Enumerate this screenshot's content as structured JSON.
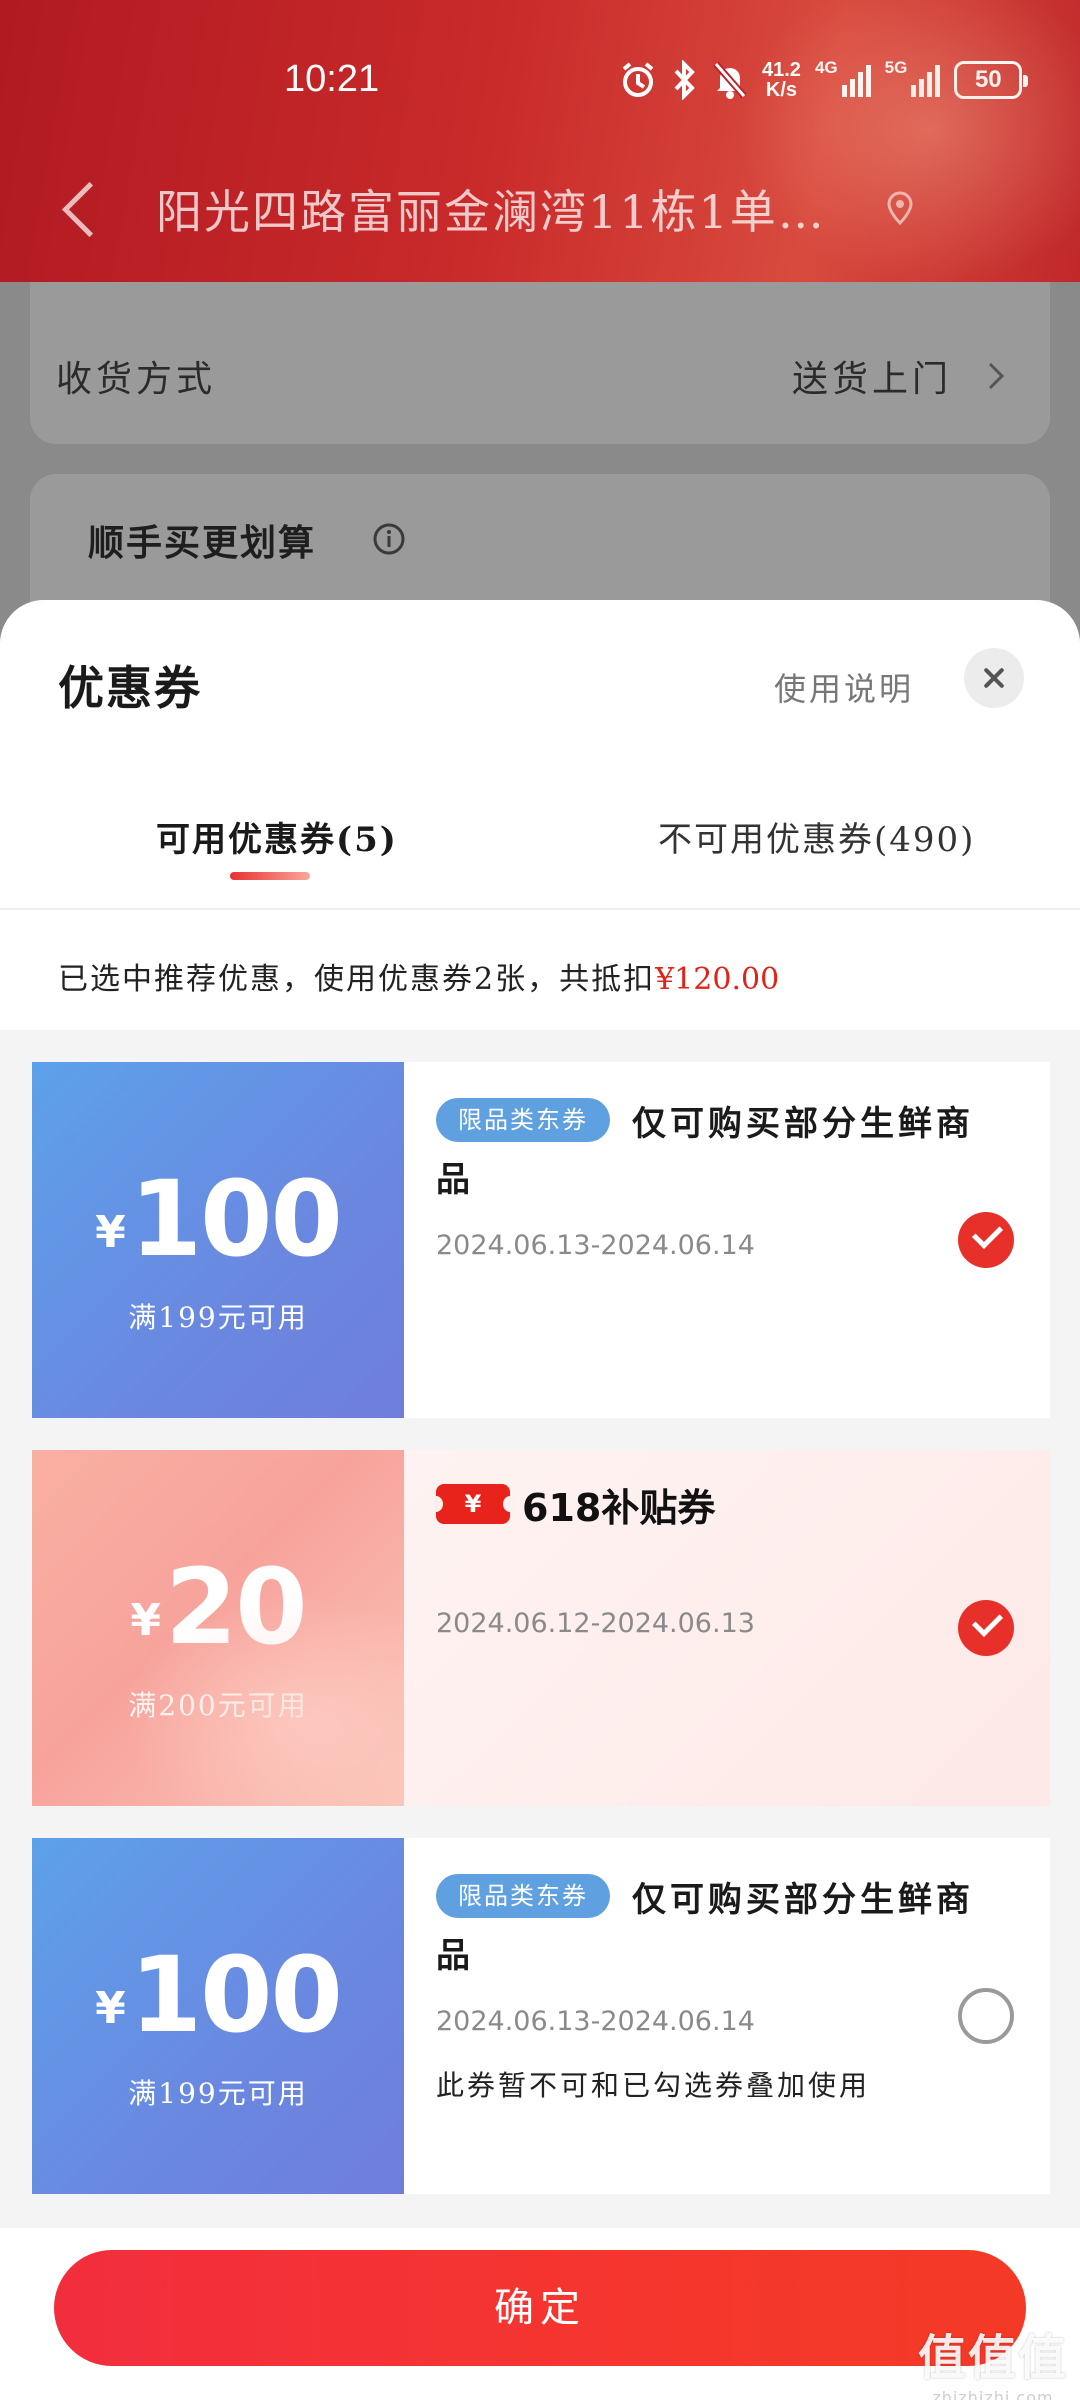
{
  "status_bar": {
    "time": "10:21",
    "net_speed_value": "41.2",
    "net_speed_unit": "K/s",
    "network_4g": "4G",
    "network_5g": "5G",
    "battery": "50"
  },
  "header": {
    "address": "阳光四路富丽金澜湾11栋1单…"
  },
  "background_page": {
    "delivery_label": "收货方式",
    "delivery_value": "送货上门",
    "bundle_title": "顺手买更划算"
  },
  "sheet": {
    "title": "优惠券",
    "usage_link": "使用说明",
    "tabs": [
      {
        "label": "可用优惠券(5)",
        "active": true
      },
      {
        "label": "不可用优惠券(490)",
        "active": false
      }
    ],
    "summary_text": "已选中推荐优惠，使用优惠券2张，共抵扣",
    "summary_amount": "¥120.00"
  },
  "coupons": [
    {
      "currency": "¥",
      "amount": "100",
      "condition": "满199元可用",
      "tag": "限品类东券",
      "title": "仅可购买部分生鲜商品",
      "date_range": "2024.06.13-2024.06.14",
      "checked": true,
      "style": "blue"
    },
    {
      "currency": "¥",
      "amount": "20",
      "condition": "满200元可用",
      "badge_symbol": "¥",
      "badge_text": "618补贴券",
      "date_range": "2024.06.12-2024.06.13",
      "checked": true,
      "style": "pink"
    },
    {
      "currency": "¥",
      "amount": "100",
      "condition": "满199元可用",
      "tag": "限品类东券",
      "title": "仅可购买部分生鲜商品",
      "date_range": "2024.06.13-2024.06.14",
      "note": "此券暂不可和已勾选券叠加使用",
      "checked": false,
      "style": "blue"
    }
  ],
  "footer": {
    "confirm_label": "确定"
  },
  "watermark": {
    "main": "值值值",
    "sub": "zhizhizhi.com"
  },
  "colors": {
    "accent_red": "#e8302a",
    "coupon_blue": "#5da1ea",
    "coupon_pink": "#f9b0a2",
    "header_red": "#b11a22"
  }
}
